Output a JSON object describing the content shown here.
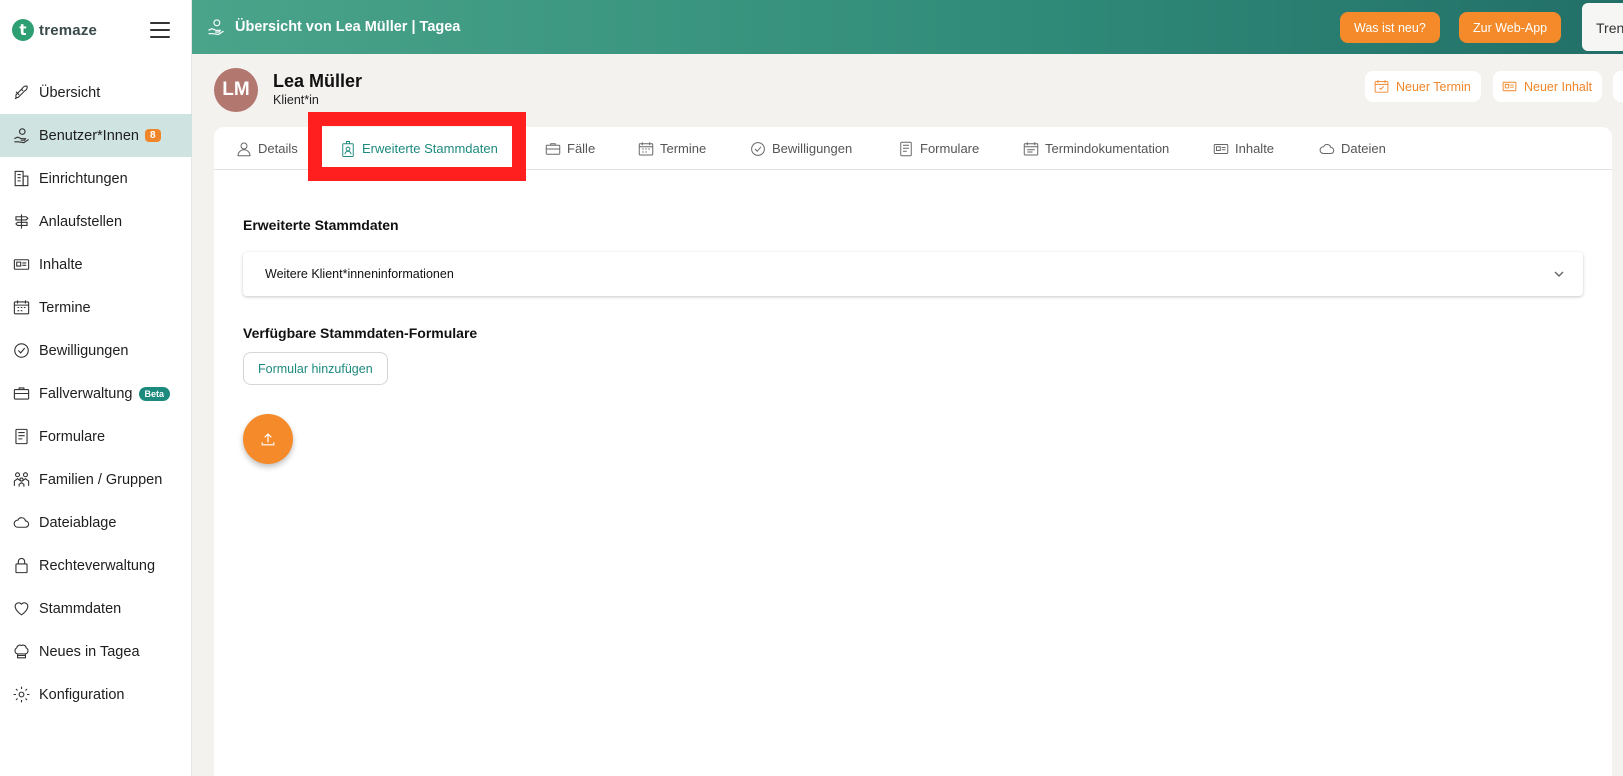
{
  "brand": {
    "name": "tremaze",
    "mark": "t"
  },
  "sidebar": {
    "items": [
      {
        "label": "Übersicht",
        "icon": "rocket-icon"
      },
      {
        "label": "Benutzer*Innen",
        "icon": "user-hand-icon",
        "badge": "8",
        "active": true
      },
      {
        "label": "Einrichtungen",
        "icon": "building-icon"
      },
      {
        "label": "Anlaufstellen",
        "icon": "signpost-icon"
      },
      {
        "label": "Inhalte",
        "icon": "newspaper-icon"
      },
      {
        "label": "Termine",
        "icon": "calendar-icon"
      },
      {
        "label": "Bewilligungen",
        "icon": "check-circle-icon"
      },
      {
        "label": "Fallverwaltung",
        "icon": "briefcase-icon",
        "badge": "Beta"
      },
      {
        "label": "Formulare",
        "icon": "form-icon"
      },
      {
        "label": "Familien / Gruppen",
        "icon": "family-icon"
      },
      {
        "label": "Dateiablage",
        "icon": "cloud-icon"
      },
      {
        "label": "Rechteverwaltung",
        "icon": "lock-icon"
      },
      {
        "label": "Stammdaten",
        "icon": "heart-icon"
      },
      {
        "label": "Neues in Tagea",
        "icon": "chef-hat-icon"
      },
      {
        "label": "Konfiguration",
        "icon": "gear-icon"
      }
    ]
  },
  "topbar": {
    "title": "Übersicht von Lea Müller | Tagea",
    "whats_new": "Was ist neu?",
    "web_app": "Zur Web-App",
    "cut_label": "Tren"
  },
  "profile": {
    "initials": "LM",
    "name": "Lea Müller",
    "role": "Klient*in",
    "new_appointment": "Neuer Termin",
    "new_content": "Neuer Inhalt"
  },
  "tabs": [
    {
      "label": "Details"
    },
    {
      "label": "Erweiterte Stammdaten",
      "active": true
    },
    {
      "label": "Fälle"
    },
    {
      "label": "Termine"
    },
    {
      "label": "Bewilligungen"
    },
    {
      "label": "Formulare"
    },
    {
      "label": "Termindokumentation"
    },
    {
      "label": "Inhalte"
    },
    {
      "label": "Dateien"
    }
  ],
  "main": {
    "section_title": "Erweiterte Stammdaten",
    "accordion_label": "Weitere Klient*inneninformationen",
    "forms_title": "Verfügbare Stammdaten-Formulare",
    "add_form_button": "Formular hinzufügen"
  },
  "colors": {
    "accent_teal": "#1d8a7e",
    "accent_orange": "#f48a2a",
    "highlight_red": "#ff1f1f",
    "active_nav_bg": "#cfe3e0"
  }
}
